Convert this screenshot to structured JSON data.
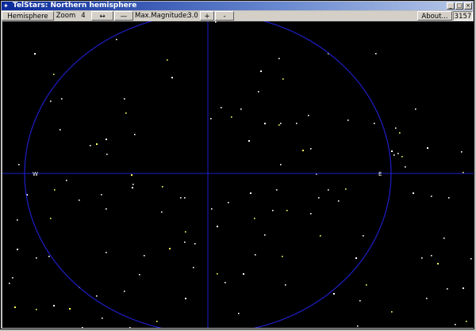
{
  "window": {
    "title": "TelStars: Northern hemisphere",
    "app_icon": "star-icon",
    "controls": [
      "minimize-icon",
      "maximize-icon",
      "close-icon"
    ]
  },
  "toolbar": {
    "hemisphere_label": "Hemisphere",
    "zoom_label": "Zoom",
    "zoom_value": "4",
    "zoom_in_label": "↔",
    "zoom_out_label": "—",
    "magnitude_label": "Max.Magnitude:",
    "magnitude_value": "3.0",
    "mag_increase_label": "+",
    "mag_decrease_label": "-",
    "about_label": "About...",
    "star_count": "3157"
  },
  "sky": {
    "west_label": "W",
    "east_label": "E",
    "colors": {
      "grid": "#1e1ec8",
      "star_white": "#ffffff",
      "star_yellow": "#ffff60"
    }
  }
}
